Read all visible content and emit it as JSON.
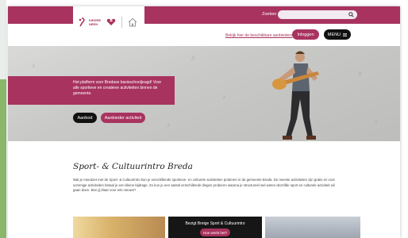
{
  "header": {
    "logo_text": "KIEDRE NEEN",
    "search_label": "Zoeken",
    "search_placeholder": "",
    "info_link": "Bekijk hier de beschikbare aanbieders",
    "login_label": "Inloggen",
    "menu_label": "MENU"
  },
  "hero": {
    "banner_text": "Het platform voor Bredase basisschooljeugd! Voor alle sportieve en creatieve activiteiten binnen de gemeente.",
    "aanbod_label": "Aanbod",
    "aanbieder_label": "Aanbieder activiteit"
  },
  "intro": {
    "title": "Sport- & Cultuurintro Breda",
    "body": "Wat je meedoet met de Sport- & Cultuurintro kun je verschillende sportieve- en culturele activiteiten proberen in de gemeente Breda. De meeste activiteiten zijn gratis en voor sommige activiteiten betaal je een kleine bijdrage. Zo kun je een aantal verschillende dingen proberen waarna je structureel wel weten dezelfde sport en culturele activiteit wil gaan doen. Ben jij klaar voor iets nieuws?"
  },
  "cards": {
    "middle_text": "Bezigt Breige Sport & Cultuurintro",
    "middle_button": "Hoe werkt het?"
  },
  "colors": {
    "brand": "#a8335f",
    "dark": "#111111"
  }
}
